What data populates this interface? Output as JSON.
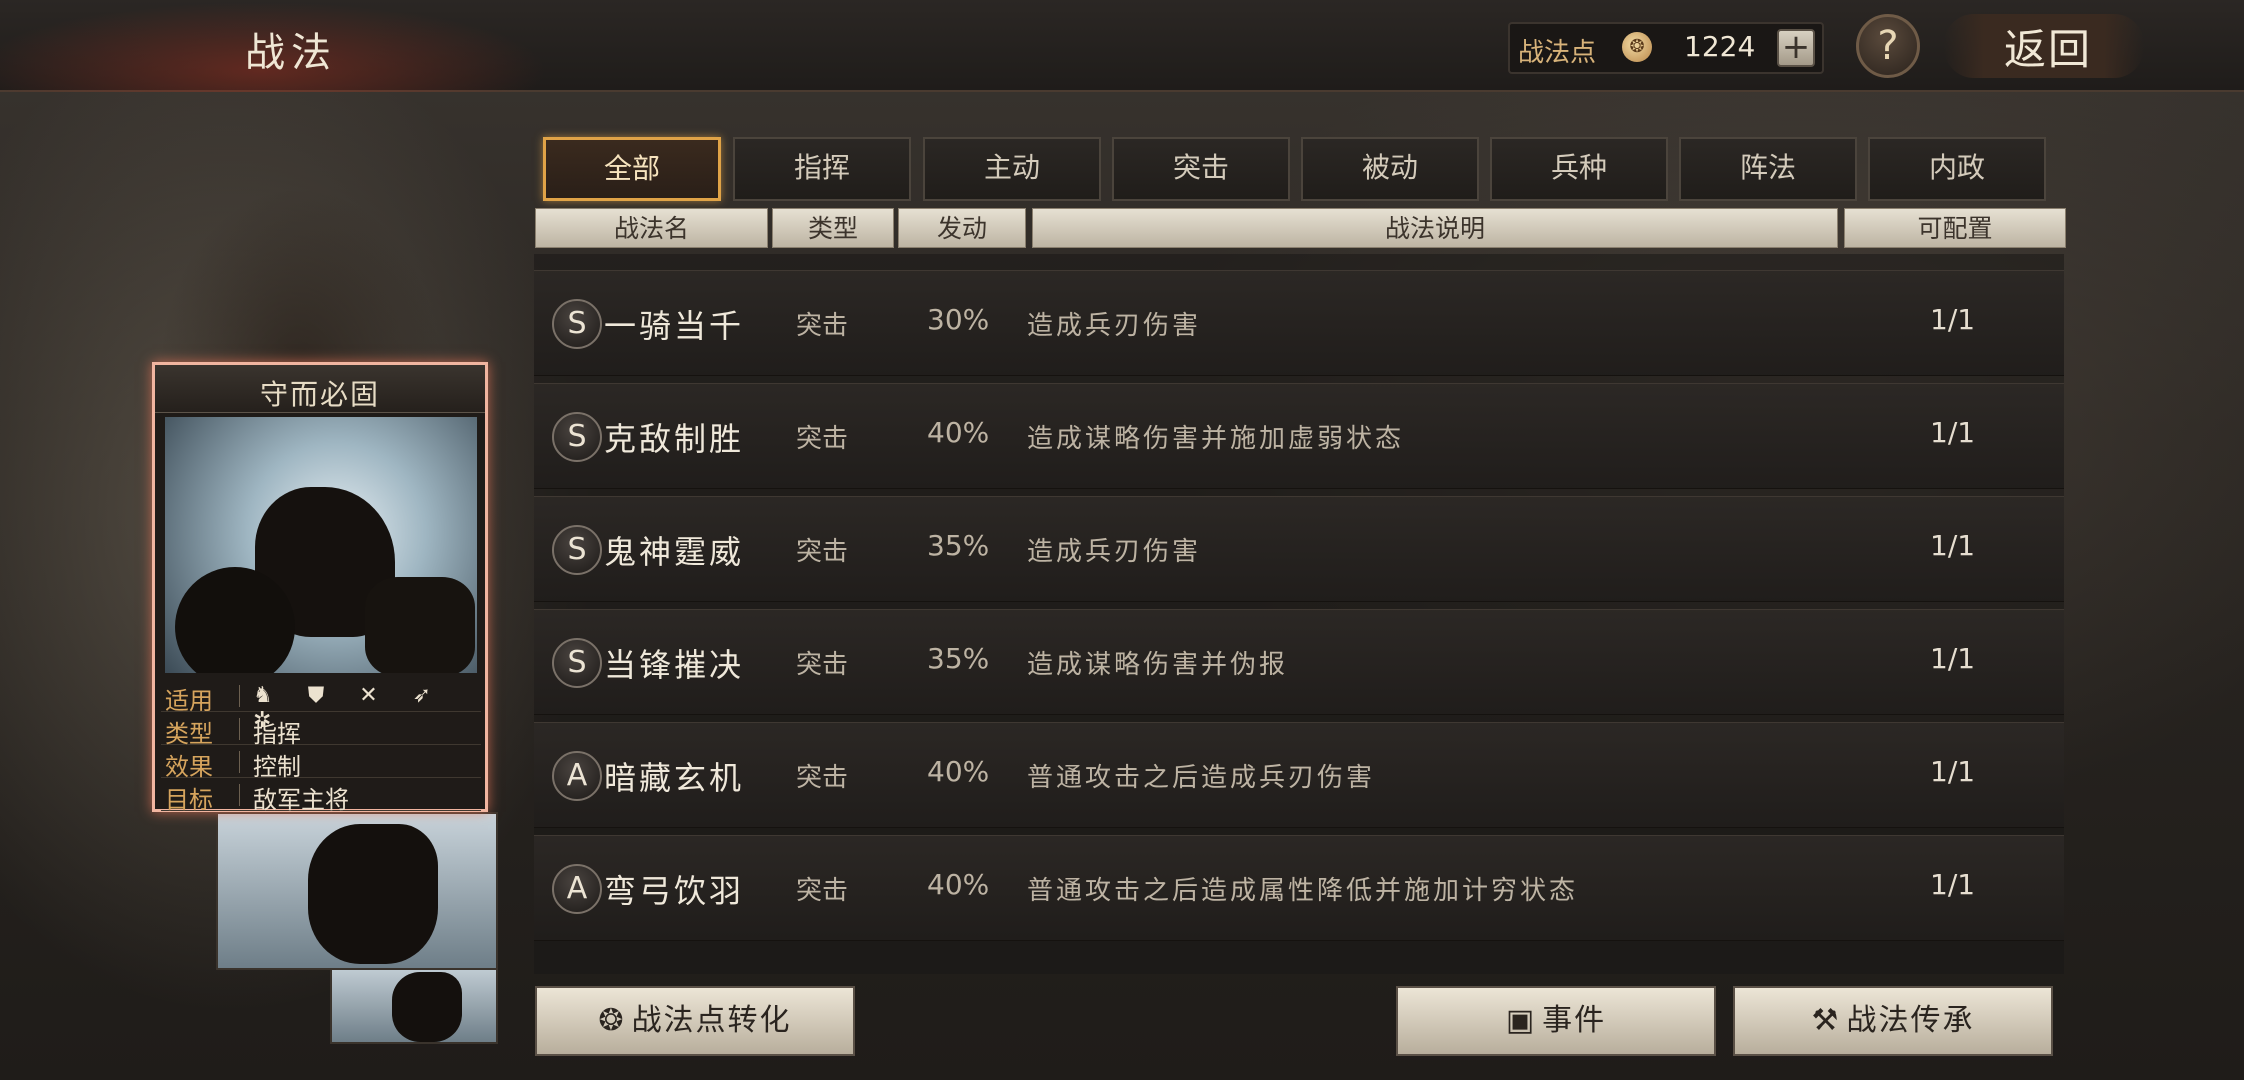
{
  "header": {
    "title": "战法",
    "points_label": "战法点",
    "points_icon": "ink-drop-icon",
    "points_value": "1224",
    "add_icon": "+",
    "help_icon": "?",
    "back_label": "返回"
  },
  "tabs": [
    {
      "label": "全部",
      "active": true
    },
    {
      "label": "指挥",
      "active": false
    },
    {
      "label": "主动",
      "active": false
    },
    {
      "label": "突击",
      "active": false
    },
    {
      "label": "被动",
      "active": false
    },
    {
      "label": "兵种",
      "active": false
    },
    {
      "label": "阵法",
      "active": false
    },
    {
      "label": "内政",
      "active": false
    }
  ],
  "columns": [
    "战法名",
    "类型",
    "发动",
    "战法说明",
    "可配置"
  ],
  "tactics": [
    {
      "grade": "S",
      "name": "一骑当千",
      "type": "突击",
      "rate": "30%",
      "desc": "造成兵刃伤害",
      "count": "1/1"
    },
    {
      "grade": "S",
      "name": "克敌制胜",
      "type": "突击",
      "rate": "40%",
      "desc": "造成谋略伤害并施加虚弱状态",
      "count": "1/1"
    },
    {
      "grade": "S",
      "name": "鬼神霆威",
      "type": "突击",
      "rate": "35%",
      "desc": "造成兵刃伤害",
      "count": "1/1"
    },
    {
      "grade": "S",
      "name": "当锋摧决",
      "type": "突击",
      "rate": "35%",
      "desc": "造成谋略伤害并伪报",
      "count": "1/1"
    },
    {
      "grade": "A",
      "name": "暗藏玄机",
      "type": "突击",
      "rate": "40%",
      "desc": "普通攻击之后造成兵刃伤害",
      "count": "1/1"
    },
    {
      "grade": "A",
      "name": "弯弓饮羽",
      "type": "突击",
      "rate": "40%",
      "desc": "普通攻击之后造成属性降低并施加计穷状态",
      "count": "1/1"
    }
  ],
  "card": {
    "title": "守而必固",
    "applies_label": "适用",
    "applies_icons": "♞ ⛊ ✕ ➶ ✲",
    "type_label": "类型",
    "type_value": "指挥",
    "effect_label": "效果",
    "effect_value": "控制",
    "target_label": "目标",
    "target_value": "敌军主将"
  },
  "buttons": {
    "convert_label": "战法点转化",
    "events_label": "事件",
    "inherit_label": "战法传承"
  }
}
